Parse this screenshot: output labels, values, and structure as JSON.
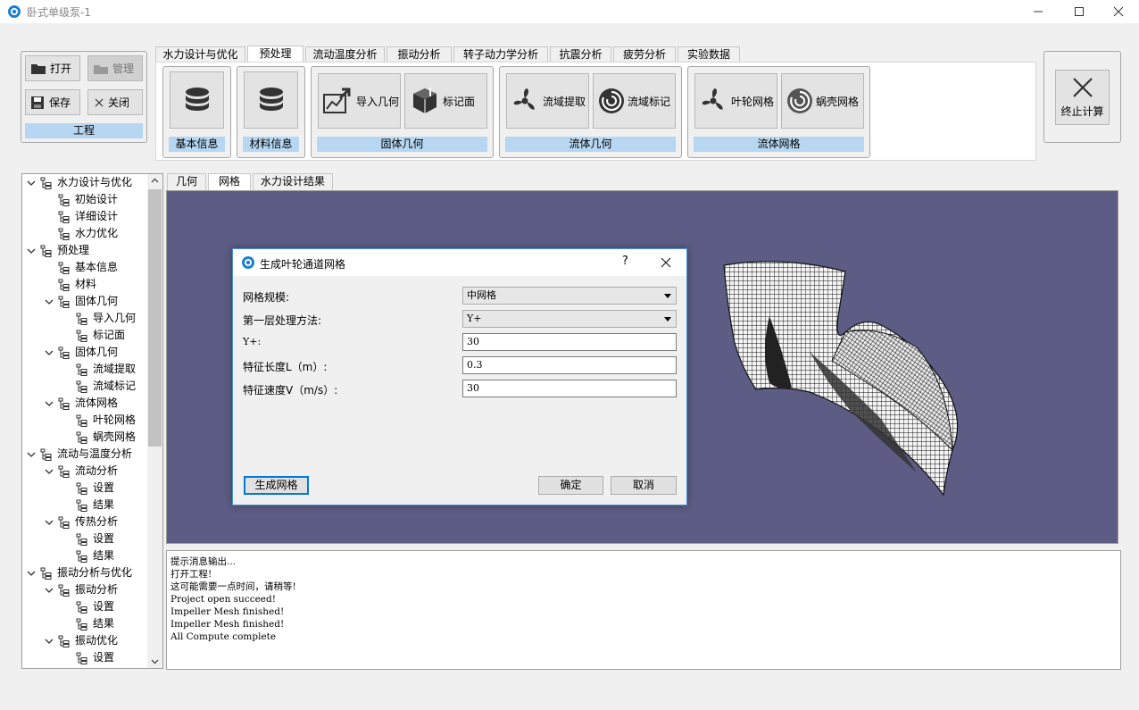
{
  "window": {
    "title": "卧式单级泵-1"
  },
  "project": {
    "open": "打开",
    "manage": "管理",
    "save": "保存",
    "close": "关闭",
    "group_label": "工程"
  },
  "main_tabs": [
    "水力设计与优化",
    "预处理",
    "流动温度分析",
    "振动分析",
    "转子动力学分析",
    "抗震分析",
    "疲劳分析",
    "实验数据"
  ],
  "ribbon": {
    "basic_info": "基本信息",
    "material_info": "材料信息",
    "import_geometry": "导入几何",
    "mark_surface": "标记面",
    "solid_geometry": "固体几何",
    "domain_extract": "流域提取",
    "domain_mark": "流域标记",
    "fluid_geometry": "流体几何",
    "impeller_mesh": "叶轮网格",
    "volute_mesh": "蜗壳网格",
    "fluid_mesh": "流体网格",
    "stop_compute": "终止计算"
  },
  "tree": [
    {
      "label": "水力设计与优化",
      "level": 0,
      "expand": true
    },
    {
      "label": "初始设计",
      "level": 1
    },
    {
      "label": "详细设计",
      "level": 1
    },
    {
      "label": "水力优化",
      "level": 1
    },
    {
      "label": "预处理",
      "level": 0,
      "expand": true
    },
    {
      "label": "基本信息",
      "level": 1
    },
    {
      "label": "材料",
      "level": 1
    },
    {
      "label": "固体几何",
      "level": 1,
      "expand": true
    },
    {
      "label": "导入几何",
      "level": 2
    },
    {
      "label": "标记面",
      "level": 2
    },
    {
      "label": "固体几何",
      "level": 1,
      "expand": true
    },
    {
      "label": "流域提取",
      "level": 2
    },
    {
      "label": "流域标记",
      "level": 2
    },
    {
      "label": "流体网格",
      "level": 1,
      "expand": true
    },
    {
      "label": "叶轮网格",
      "level": 2
    },
    {
      "label": "蜗壳网格",
      "level": 2
    },
    {
      "label": "流动与温度分析",
      "level": 0,
      "expand": true
    },
    {
      "label": "流动分析",
      "level": 1,
      "expand": true
    },
    {
      "label": "设置",
      "level": 2
    },
    {
      "label": "结果",
      "level": 2
    },
    {
      "label": "传热分析",
      "level": 1,
      "expand": true
    },
    {
      "label": "设置",
      "level": 2
    },
    {
      "label": "结果",
      "level": 2
    },
    {
      "label": "振动分析与优化",
      "level": 0,
      "expand": true
    },
    {
      "label": "振动分析",
      "level": 1,
      "expand": true
    },
    {
      "label": "设置",
      "level": 2
    },
    {
      "label": "结果",
      "level": 2
    },
    {
      "label": "振动优化",
      "level": 1,
      "expand": true
    },
    {
      "label": "设置",
      "level": 2
    }
  ],
  "content_tabs": [
    "几何",
    "网格",
    "水力设计结果"
  ],
  "log_lines": [
    "提示消息输出...",
    "打开工程!",
    "这可能需要一点时间，请稍等!",
    "Project open succeed!",
    "Impeller Mesh finished!",
    "Impeller Mesh finished!",
    "All Compute complete"
  ],
  "dialog": {
    "title": "生成叶轮通道网格",
    "help": "?",
    "mesh_scale_label": "网格规模:",
    "mesh_scale_value": "中网格",
    "first_layer_label": "第一层处理方法:",
    "first_layer_value": "Y+",
    "yplus_label": "Y+:",
    "yplus_value": "30",
    "length_label": "特征长度L（m）:",
    "length_value": "0.3",
    "velocity_label": "特征速度V（m/s）:",
    "velocity_value": "30",
    "generate_button": "生成网格",
    "ok_button": "确定",
    "cancel_button": "取消"
  },
  "colors": {
    "accent": "#b6d6f2",
    "viewport": "#5c5c84",
    "dialog_border": "#4a90d9"
  }
}
